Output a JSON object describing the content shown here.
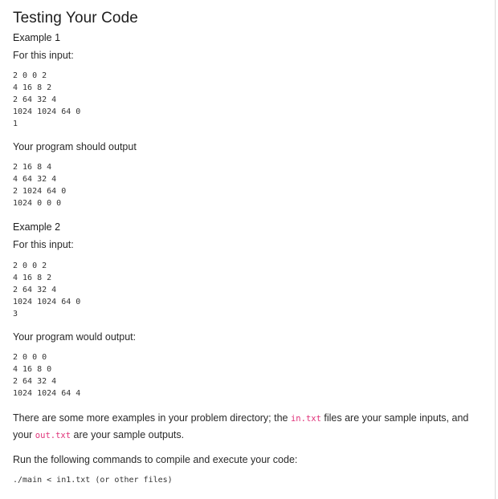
{
  "title": "Testing Your Code",
  "example1": {
    "heading": "Example 1",
    "input_label": "For this input:",
    "input": "2 0 0 2\n4 16 8 2\n2 64 32 4\n1024 1024 64 0\n1",
    "output_label": "Your program should output",
    "output": "2 16 8 4\n4 64 32 4\n2 1024 64 0\n1024 0 0 0"
  },
  "example2": {
    "heading": "Example 2",
    "input_label": "For this input:",
    "input": "2 0 0 2\n4 16 8 2\n2 64 32 4\n1024 1024 64 0\n3",
    "output_label": "Your program would output:",
    "output": "2 0 0 0\n4 16 8 0\n2 64 32 4\n1024 1024 64 4"
  },
  "more_examples": {
    "text_before": "There are some more examples in your problem directory; the ",
    "in_file": "in.txt",
    "text_middle": " files are your sample inputs, and your ",
    "out_file": "out.txt",
    "text_after": " are your sample outputs."
  },
  "run_instructions": "Run the following commands to compile and execute your code:",
  "command": "./main < in1.txt (or other files)"
}
